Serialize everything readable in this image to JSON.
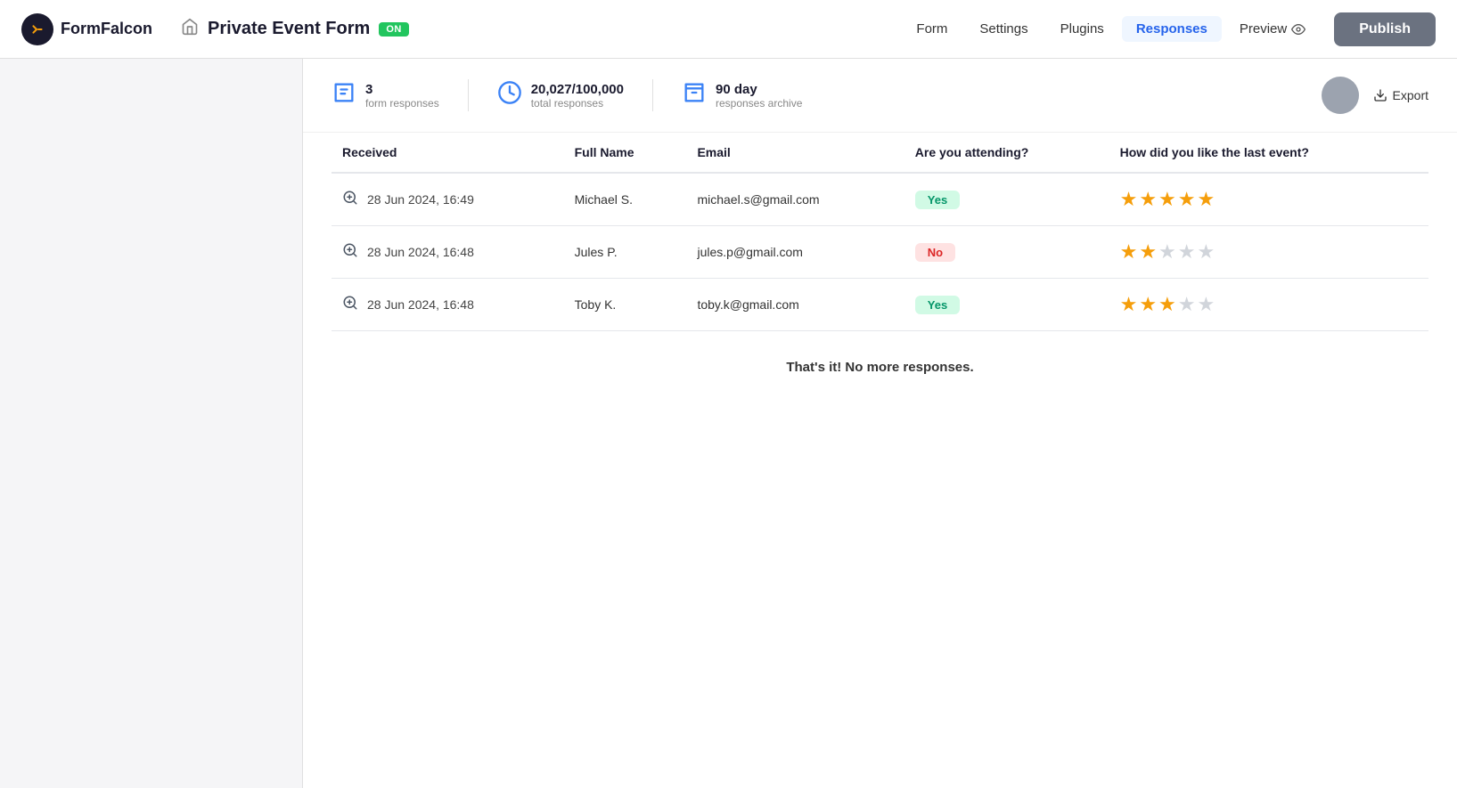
{
  "brand": {
    "name": "FormFalcon"
  },
  "header": {
    "home_icon": "🏠",
    "form_title": "Private Event Form",
    "on_badge": "ON",
    "nav_links": [
      {
        "id": "form",
        "label": "Form",
        "active": false
      },
      {
        "id": "settings",
        "label": "Settings",
        "active": false
      },
      {
        "id": "plugins",
        "label": "Plugins",
        "active": false
      },
      {
        "id": "responses",
        "label": "Responses",
        "active": true
      },
      {
        "id": "preview",
        "label": "Preview",
        "active": false
      }
    ],
    "publish_label": "Publish"
  },
  "stats": {
    "form_responses_count": "3",
    "form_responses_label": "form responses",
    "total_responses_count": "20,027/100,000",
    "total_responses_label": "total responses",
    "archive_days": "90 day",
    "archive_label": "responses archive",
    "export_label": "Export"
  },
  "table": {
    "columns": [
      "Received",
      "Full Name",
      "Email",
      "Are you attending?",
      "How did you like the last event?"
    ],
    "rows": [
      {
        "received": "28 Jun 2024, 16:49",
        "full_name": "Michael S.",
        "email": "michael.s@gmail.com",
        "attending": "Yes",
        "attending_type": "yes",
        "stars_filled": 5,
        "stars_empty": 0
      },
      {
        "received": "28 Jun 2024, 16:48",
        "full_name": "Jules P.",
        "email": "jules.p@gmail.com",
        "attending": "No",
        "attending_type": "no",
        "stars_filled": 2,
        "stars_empty": 3
      },
      {
        "received": "28 Jun 2024, 16:48",
        "full_name": "Toby K.",
        "email": "toby.k@gmail.com",
        "attending": "Yes",
        "attending_type": "yes",
        "stars_filled": 3,
        "stars_empty": 2
      }
    ]
  },
  "footer": {
    "no_more_text": "That's it! No more responses."
  }
}
